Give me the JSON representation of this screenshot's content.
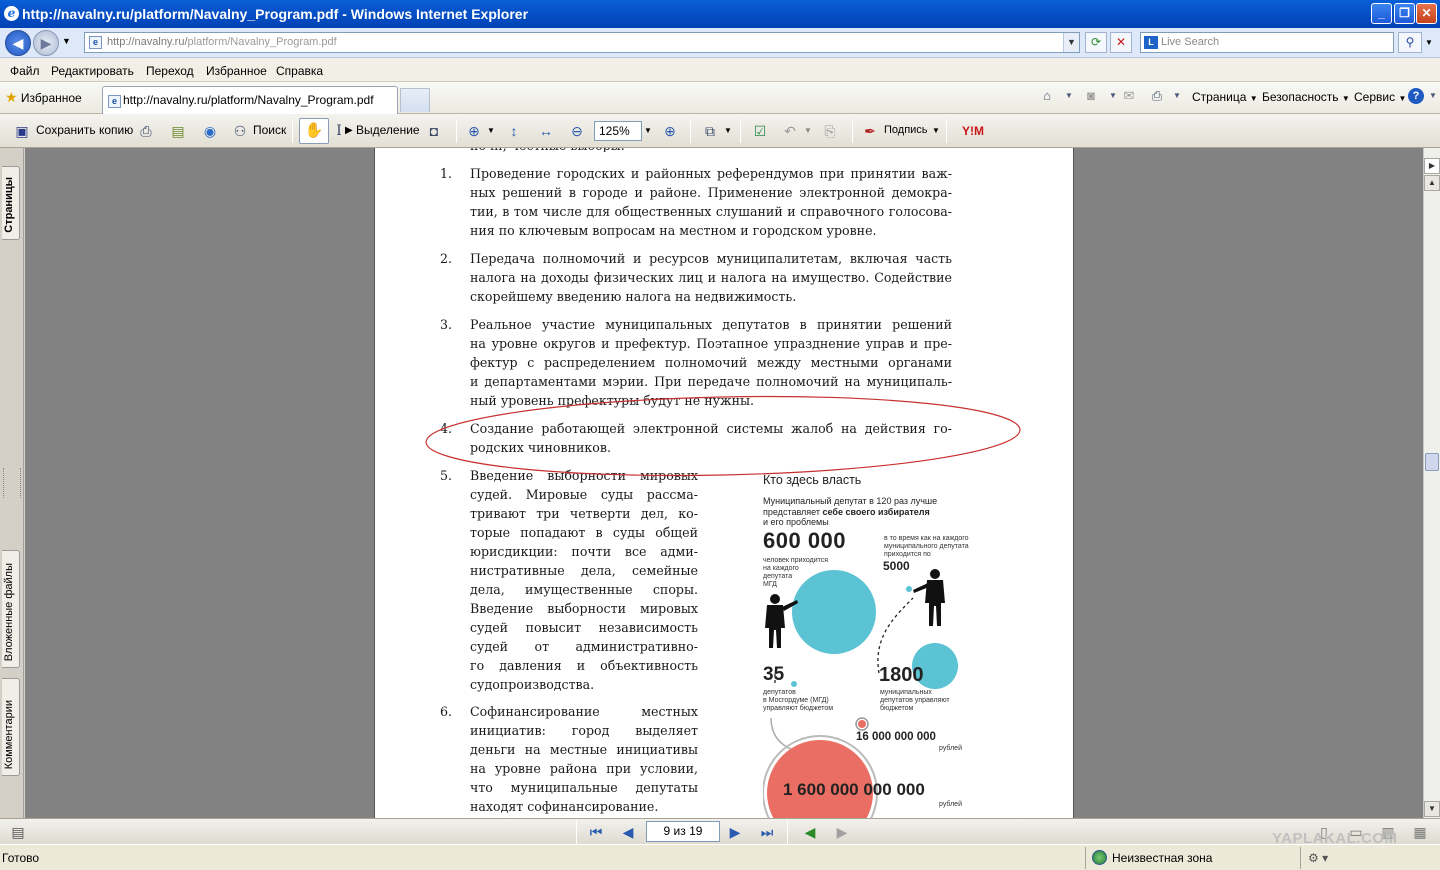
{
  "window": {
    "title": "http://navalny.ru/platform/Navalny_Program.pdf - Windows Internet Explorer",
    "minimize_icon": "minimize-icon",
    "maximize_icon": "maximize-icon",
    "close_icon": "close-icon"
  },
  "address_bar": {
    "url_prefix": "http://navalny.ru/",
    "url_path": "platform/Navalny_Program.pdf",
    "search_placeholder": "Live Search"
  },
  "menu": [
    "Файл",
    "Редактировать",
    "Переход",
    "Избранное",
    "Справка"
  ],
  "favorites_label": "Избранное",
  "tab_title": "http://navalny.ru/platform/Navalny_Program.pdf",
  "command_bar": {
    "page": "Страница",
    "safety": "Безопасность",
    "tools": "Сервис"
  },
  "pdf_toolbar": {
    "save_copy": "Сохранить копию",
    "search": "Поиск",
    "select": "Выделение",
    "zoom": "125%",
    "sign": "Подпись"
  },
  "left_tabs": {
    "pages": "Страницы",
    "attachments": "Вложенные файлы",
    "comments": "Комментарии"
  },
  "document": {
    "items": [
      {
        "num": "1.",
        "lines": [
          "Проведение городских и районных референдумов при принятии важ-",
          "ных решений в городе и районе. Применение электронной демокра-",
          "тии, в том числе для общественных слушаний и справочного голосова-",
          "ния по ключевым вопросам на местном и городском уровне."
        ]
      },
      {
        "num": "2.",
        "lines": [
          "Передача полномочий и ресурсов муниципалитетам, включая часть",
          "налога на доходы физических лиц и налога на имущество. Содействие",
          "скорейшему введению налога на недвижимость."
        ]
      },
      {
        "num": "3.",
        "lines": [
          "Реальное участие муниципальных депутатов в принятии решений",
          "на уровне округов и префектур. Поэтапное упразднение управ и пре-",
          "фектур с распределением полномочий между местными органами",
          "и департаментами мэрии. При передаче полномочий на муниципаль-",
          "ный уровень префектуры будут не нужны."
        ]
      },
      {
        "num": "4.",
        "lines": [
          "Создание работающей электронной системы жалоб на действия го-",
          "родских чиновников."
        ]
      },
      {
        "num": "5.",
        "lines": [
          "Введение выборности мировых",
          "судей. Мировые суды рассма-",
          "тривают три четверти дел, ко-",
          "торые попадают в суды общей",
          "юрисдикции: почти все адми-",
          "нистративные дела, семейные",
          "дела, имущественные споры.",
          "Введение выборности мировых",
          "судей повысит независимость",
          "судей от административно-",
          "го давления и объективность",
          "судопроизводства."
        ]
      },
      {
        "num": "6.",
        "lines": [
          "Софинансирование местных",
          "инициатив: город выделяет",
          "деньги на местные инициативы",
          "на уровне района при условии,",
          "что муниципальные депутаты",
          "находят софинансирование."
        ]
      }
    ],
    "infographic": {
      "title": "Кто здесь власть",
      "subtitle_l1": "Муниципальный депутат в 120 раз лучше",
      "subtitle_l2_a": "представляет ",
      "subtitle_l2_b": "себе своего избирателя",
      "subtitle_l3": "и его проблемы",
      "big1": "600 000",
      "big1_caption": [
        "человек приходится",
        "на каждого",
        "депутата",
        "МГД"
      ],
      "mid_caption": [
        "в то время как на каждого",
        "муниципального депутата",
        "приходится по"
      ],
      "big2": "5000",
      "num35": "35",
      "num35_caption": [
        "депутатов",
        "в Мосгордуме (МГД)",
        "управляют бюджетом"
      ],
      "num1800": "1800",
      "num1800_caption": [
        "муниципальных",
        "депутатов управляют",
        "бюджетом"
      ],
      "budget_small": "16 000 000 000",
      "budget_small_unit": "рублей",
      "budget_big": "1 600 000 000 000",
      "budget_big_unit": "рублей",
      "color_teal": "#5bc3d3",
      "color_red": "#ea6e63"
    }
  },
  "bottom_nav": {
    "page_field": "9 из 19"
  },
  "status": {
    "left": "Готово",
    "zone": "Неизвестная зона"
  },
  "watermark": "YAPLAKAL.COM"
}
